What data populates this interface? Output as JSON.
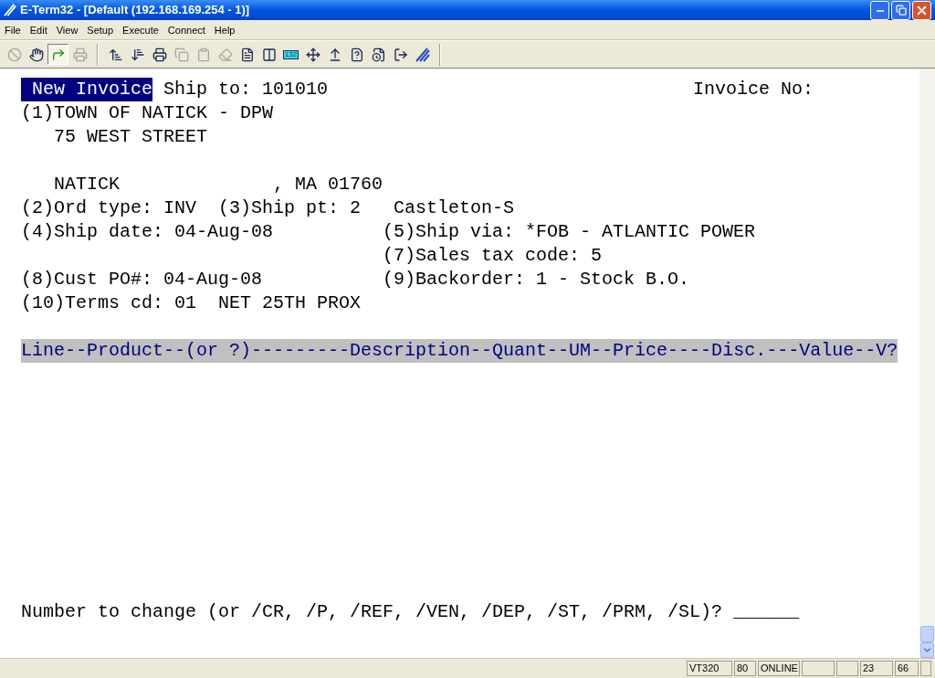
{
  "window": {
    "title": "E-Term32 - [Default (192.168.169.254 - 1)]"
  },
  "menu": [
    "File",
    "Edit",
    "View",
    "Setup",
    "Execute",
    "Connect",
    "Help"
  ],
  "toolbar": [
    {
      "kind": "icon",
      "disabled": true,
      "pressed": false
    },
    {
      "kind": "icon",
      "disabled": false,
      "pressed": false
    },
    {
      "kind": "icon",
      "disabled": false,
      "pressed": true
    },
    {
      "kind": "icon",
      "disabled": true,
      "pressed": false
    },
    {
      "kind": "icon",
      "disabled": false,
      "pressed": false
    },
    {
      "kind": "icon",
      "disabled": false,
      "pressed": false
    },
    {
      "kind": "icon",
      "disabled": false,
      "pressed": false
    },
    {
      "kind": "icon",
      "disabled": true,
      "pressed": false
    },
    {
      "kind": "icon",
      "disabled": true,
      "pressed": false
    },
    {
      "kind": "icon",
      "disabled": true,
      "pressed": false
    },
    {
      "kind": "icon",
      "disabled": false,
      "pressed": false
    },
    {
      "kind": "icon",
      "disabled": false,
      "pressed": false
    },
    {
      "kind": "label",
      "label": "132",
      "disabled": false,
      "pressed": false
    },
    {
      "kind": "icon",
      "disabled": false,
      "pressed": false
    },
    {
      "kind": "icon",
      "disabled": false,
      "pressed": false
    },
    {
      "kind": "icon",
      "disabled": false,
      "pressed": false
    },
    {
      "kind": "icon",
      "disabled": false,
      "pressed": false
    },
    {
      "kind": "icon",
      "disabled": false,
      "pressed": false
    },
    {
      "kind": "icon",
      "disabled": false,
      "pressed": false
    }
  ],
  "screen": {
    "rows": [
      {
        "kind": "title",
        "badge": "New Invoice",
        "left": "Ship to: 101010",
        "far": "Invoice No:"
      },
      {
        "kind": "line",
        "left": "(1)TOWN OF NATICK - DPW"
      },
      {
        "kind": "line",
        "indent": true,
        "left": "75 WEST STREET"
      },
      {
        "kind": "blank"
      },
      {
        "kind": "line",
        "indent": true,
        "left": "NATICK              , MA 01760"
      },
      {
        "kind": "line",
        "left": "(2)Ord type: INV  (3)Ship pt: 2   Castleton-S"
      },
      {
        "kind": "line",
        "left": "(4)Ship date: 04-Aug-08",
        "right": "(5)Ship via: *FOB - ATLANTIC POWER"
      },
      {
        "kind": "line",
        "right": "(7)Sales tax code: 5"
      },
      {
        "kind": "line",
        "left": "(8)Cust PO#: 04-Aug-08",
        "right": "(9)Backorder: 1 - Stock B.O."
      },
      {
        "kind": "line",
        "left": "(10)Terms cd: 01  NET 25TH PROX"
      },
      {
        "kind": "blank"
      },
      {
        "kind": "header",
        "left": "Line--Product--(or ?)---------Description--Quant--UM--Price----Disc.---Value--V?"
      },
      {
        "kind": "blank"
      },
      {
        "kind": "blank"
      },
      {
        "kind": "blank"
      },
      {
        "kind": "blank"
      },
      {
        "kind": "blank"
      },
      {
        "kind": "blank"
      },
      {
        "kind": "blank"
      },
      {
        "kind": "blank"
      },
      {
        "kind": "blank"
      },
      {
        "kind": "blank"
      },
      {
        "kind": "prompt",
        "left": "Number to change (or /CR, /P, /REF, /VEN, /DEP, /ST, /PRM, /SL)?",
        "input": "______"
      }
    ]
  },
  "status_bar": [
    "VT320",
    "80",
    "ONLINE",
    "23",
    "66"
  ]
}
